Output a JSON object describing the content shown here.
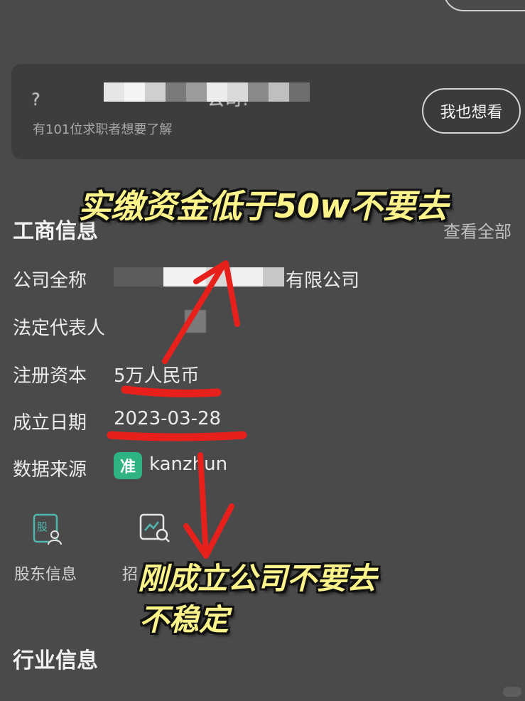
{
  "promo": {
    "question_prefix": "?",
    "question_suffix": "公司?",
    "subtitle": "有101位求职者想要了解",
    "button_label": "我也想看"
  },
  "business": {
    "title": "工商信息",
    "view_all": "查看全部",
    "rows": [
      {
        "label": "公司全称",
        "value": "有限公司"
      },
      {
        "label": "法定代表人",
        "value": ""
      },
      {
        "label": "注册资本",
        "value": "5万人民币"
      },
      {
        "label": "成立日期",
        "value": "2023-03-28"
      },
      {
        "label": "数据来源",
        "value": "kanzhun"
      }
    ],
    "source_badge": "准"
  },
  "functions": [
    {
      "label": "股东信息",
      "icon": "shareholder-icon",
      "icon_char": "股"
    },
    {
      "label": "招",
      "icon": "recruit-search-icon"
    }
  ],
  "industry": {
    "title": "行业信息"
  },
  "annotations": {
    "top": "实缴资金低于50w不要去",
    "bottom_line1": "刚成立公司不要去",
    "bottom_line2": "不稳定"
  },
  "colors": {
    "background": "#4a4a4a",
    "card": "#3d3d3d",
    "annotation_text": "#fcf48a",
    "arrow": "#e8201c",
    "badge": "#2fb383"
  }
}
